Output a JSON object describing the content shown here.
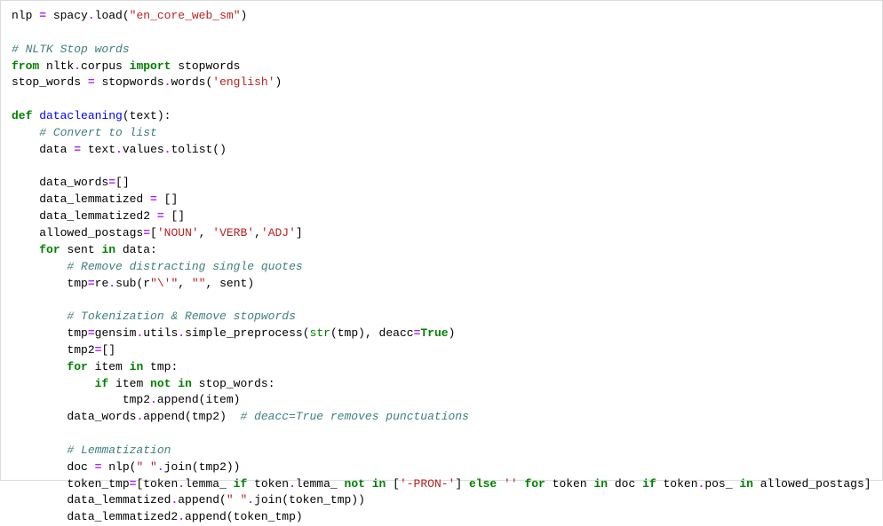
{
  "code": {
    "lines": [
      [
        {
          "c": "tk-name",
          "t": "nlp "
        },
        {
          "c": "tk-op",
          "t": "="
        },
        {
          "c": "tk-name",
          "t": " spacy"
        },
        {
          "c": "tk-op",
          "t": "."
        },
        {
          "c": "tk-name",
          "t": "load("
        },
        {
          "c": "tk-str",
          "t": "\"en_core_web_sm\""
        },
        {
          "c": "tk-name",
          "t": ")"
        }
      ],
      [],
      [
        {
          "c": "tk-comment",
          "t": "# NLTK Stop words"
        }
      ],
      [
        {
          "c": "tk-kw",
          "t": "from"
        },
        {
          "c": "tk-name",
          "t": " nltk"
        },
        {
          "c": "tk-op",
          "t": "."
        },
        {
          "c": "tk-name",
          "t": "corpus "
        },
        {
          "c": "tk-kw",
          "t": "import"
        },
        {
          "c": "tk-name",
          "t": " stopwords"
        }
      ],
      [
        {
          "c": "tk-name",
          "t": "stop_words "
        },
        {
          "c": "tk-op",
          "t": "="
        },
        {
          "c": "tk-name",
          "t": " stopwords"
        },
        {
          "c": "tk-op",
          "t": "."
        },
        {
          "c": "tk-name",
          "t": "words("
        },
        {
          "c": "tk-str",
          "t": "'english'"
        },
        {
          "c": "tk-name",
          "t": ")"
        }
      ],
      [],
      [
        {
          "c": "tk-kw",
          "t": "def"
        },
        {
          "c": "tk-name",
          "t": " "
        },
        {
          "c": "tk-func",
          "t": "datacleaning"
        },
        {
          "c": "tk-name",
          "t": "(text):"
        }
      ],
      [
        {
          "c": "tk-name",
          "t": "    "
        },
        {
          "c": "tk-comment",
          "t": "# Convert to list"
        }
      ],
      [
        {
          "c": "tk-name",
          "t": "    data "
        },
        {
          "c": "tk-op",
          "t": "="
        },
        {
          "c": "tk-name",
          "t": " text"
        },
        {
          "c": "tk-op",
          "t": "."
        },
        {
          "c": "tk-name",
          "t": "values"
        },
        {
          "c": "tk-op",
          "t": "."
        },
        {
          "c": "tk-name",
          "t": "tolist()"
        }
      ],
      [],
      [
        {
          "c": "tk-name",
          "t": "    data_words"
        },
        {
          "c": "tk-op",
          "t": "="
        },
        {
          "c": "tk-name",
          "t": "[]"
        }
      ],
      [
        {
          "c": "tk-name",
          "t": "    data_lemmatized "
        },
        {
          "c": "tk-op",
          "t": "="
        },
        {
          "c": "tk-name",
          "t": " []"
        }
      ],
      [
        {
          "c": "tk-name",
          "t": "    data_lemmatized2 "
        },
        {
          "c": "tk-op",
          "t": "="
        },
        {
          "c": "tk-name",
          "t": " []"
        }
      ],
      [
        {
          "c": "tk-name",
          "t": "    allowed_postags"
        },
        {
          "c": "tk-op",
          "t": "="
        },
        {
          "c": "tk-name",
          "t": "["
        },
        {
          "c": "tk-str",
          "t": "'NOUN'"
        },
        {
          "c": "tk-name",
          "t": ", "
        },
        {
          "c": "tk-str",
          "t": "'VERB'"
        },
        {
          "c": "tk-name",
          "t": ","
        },
        {
          "c": "tk-str",
          "t": "'ADJ'"
        },
        {
          "c": "tk-name",
          "t": "]"
        }
      ],
      [
        {
          "c": "tk-name",
          "t": "    "
        },
        {
          "c": "tk-kw",
          "t": "for"
        },
        {
          "c": "tk-name",
          "t": " sent "
        },
        {
          "c": "tk-kw",
          "t": "in"
        },
        {
          "c": "tk-name",
          "t": " data:"
        }
      ],
      [
        {
          "c": "tk-name",
          "t": "        "
        },
        {
          "c": "tk-comment",
          "t": "# Remove distracting single quotes"
        }
      ],
      [
        {
          "c": "tk-name",
          "t": "        tmp"
        },
        {
          "c": "tk-op",
          "t": "="
        },
        {
          "c": "tk-name",
          "t": "re"
        },
        {
          "c": "tk-op",
          "t": "."
        },
        {
          "c": "tk-name",
          "t": "sub(r"
        },
        {
          "c": "tk-str",
          "t": "\"\\'\""
        },
        {
          "c": "tk-name",
          "t": ", "
        },
        {
          "c": "tk-str",
          "t": "\"\""
        },
        {
          "c": "tk-name",
          "t": ", sent)"
        }
      ],
      [],
      [
        {
          "c": "tk-name",
          "t": "        "
        },
        {
          "c": "tk-comment",
          "t": "# Tokenization & Remove stopwords"
        }
      ],
      [
        {
          "c": "tk-name",
          "t": "        tmp"
        },
        {
          "c": "tk-op",
          "t": "="
        },
        {
          "c": "tk-name",
          "t": "gensim"
        },
        {
          "c": "tk-op",
          "t": "."
        },
        {
          "c": "tk-name",
          "t": "utils"
        },
        {
          "c": "tk-op",
          "t": "."
        },
        {
          "c": "tk-name",
          "t": "simple_preprocess("
        },
        {
          "c": "tk-builtin",
          "t": "str"
        },
        {
          "c": "tk-name",
          "t": "(tmp), deacc"
        },
        {
          "c": "tk-op",
          "t": "="
        },
        {
          "c": "tk-kw",
          "t": "True"
        },
        {
          "c": "tk-name",
          "t": ")"
        }
      ],
      [
        {
          "c": "tk-name",
          "t": "        tmp2"
        },
        {
          "c": "tk-op",
          "t": "="
        },
        {
          "c": "tk-name",
          "t": "[]"
        }
      ],
      [
        {
          "c": "tk-name",
          "t": "        "
        },
        {
          "c": "tk-kw",
          "t": "for"
        },
        {
          "c": "tk-name",
          "t": " item "
        },
        {
          "c": "tk-kw",
          "t": "in"
        },
        {
          "c": "tk-name",
          "t": " tmp:"
        }
      ],
      [
        {
          "c": "tk-name",
          "t": "            "
        },
        {
          "c": "tk-kw",
          "t": "if"
        },
        {
          "c": "tk-name",
          "t": " item "
        },
        {
          "c": "tk-kw",
          "t": "not"
        },
        {
          "c": "tk-name",
          "t": " "
        },
        {
          "c": "tk-kw",
          "t": "in"
        },
        {
          "c": "tk-name",
          "t": " stop_words:"
        }
      ],
      [
        {
          "c": "tk-name",
          "t": "                tmp2"
        },
        {
          "c": "tk-op",
          "t": "."
        },
        {
          "c": "tk-name",
          "t": "append(item)"
        }
      ],
      [
        {
          "c": "tk-name",
          "t": "        data_words"
        },
        {
          "c": "tk-op",
          "t": "."
        },
        {
          "c": "tk-name",
          "t": "append(tmp2)  "
        },
        {
          "c": "tk-comment",
          "t": "# deacc=True removes punctuations"
        }
      ],
      [],
      [
        {
          "c": "tk-name",
          "t": "        "
        },
        {
          "c": "tk-comment",
          "t": "# Lemmatization"
        }
      ],
      [
        {
          "c": "tk-name",
          "t": "        doc "
        },
        {
          "c": "tk-op",
          "t": "="
        },
        {
          "c": "tk-name",
          "t": " nlp("
        },
        {
          "c": "tk-str",
          "t": "\" \""
        },
        {
          "c": "tk-op",
          "t": "."
        },
        {
          "c": "tk-name",
          "t": "join(tmp2))"
        }
      ],
      [
        {
          "c": "tk-name",
          "t": "        token_tmp"
        },
        {
          "c": "tk-op",
          "t": "="
        },
        {
          "c": "tk-name",
          "t": "[token"
        },
        {
          "c": "tk-op",
          "t": "."
        },
        {
          "c": "tk-name",
          "t": "lemma_ "
        },
        {
          "c": "tk-kw",
          "t": "if"
        },
        {
          "c": "tk-name",
          "t": " token"
        },
        {
          "c": "tk-op",
          "t": "."
        },
        {
          "c": "tk-name",
          "t": "lemma_ "
        },
        {
          "c": "tk-kw",
          "t": "not"
        },
        {
          "c": "tk-name",
          "t": " "
        },
        {
          "c": "tk-kw",
          "t": "in"
        },
        {
          "c": "tk-name",
          "t": " ["
        },
        {
          "c": "tk-str",
          "t": "'-PRON-'"
        },
        {
          "c": "tk-name",
          "t": "] "
        },
        {
          "c": "tk-kw",
          "t": "else"
        },
        {
          "c": "tk-name",
          "t": " "
        },
        {
          "c": "tk-str",
          "t": "''"
        },
        {
          "c": "tk-name",
          "t": " "
        },
        {
          "c": "tk-kw",
          "t": "for"
        },
        {
          "c": "tk-name",
          "t": " token "
        },
        {
          "c": "tk-kw",
          "t": "in"
        },
        {
          "c": "tk-name",
          "t": " doc "
        },
        {
          "c": "tk-kw",
          "t": "if"
        },
        {
          "c": "tk-name",
          "t": " token"
        },
        {
          "c": "tk-op",
          "t": "."
        },
        {
          "c": "tk-name",
          "t": "pos_ "
        },
        {
          "c": "tk-kw",
          "t": "in"
        },
        {
          "c": "tk-name",
          "t": " allowed_postags]"
        }
      ],
      [
        {
          "c": "tk-name",
          "t": "        data_lemmatized"
        },
        {
          "c": "tk-op",
          "t": "."
        },
        {
          "c": "tk-name",
          "t": "append("
        },
        {
          "c": "tk-str",
          "t": "\" \""
        },
        {
          "c": "tk-op",
          "t": "."
        },
        {
          "c": "tk-name",
          "t": "join(token_tmp))"
        }
      ],
      [
        {
          "c": "tk-name",
          "t": "        data_lemmatized2"
        },
        {
          "c": "tk-op",
          "t": "."
        },
        {
          "c": "tk-name",
          "t": "append(token_tmp)"
        }
      ]
    ]
  }
}
